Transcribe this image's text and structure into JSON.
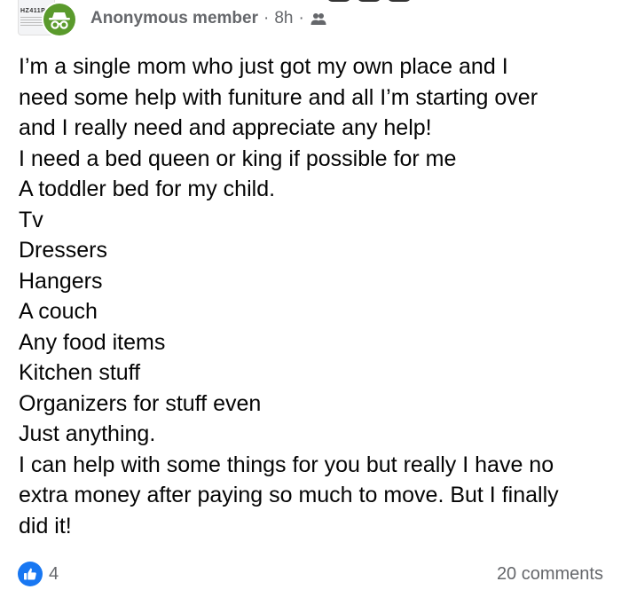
{
  "post": {
    "author": "Anonymous member",
    "separator": "·",
    "time": "8h",
    "privacy_icon": "group-privacy-icon",
    "body": "I’m a single mom who just got my own place and I\nneed some help with funiture and all I’m starting over\nand I really need and appreciate any help!\nI need a bed queen or king if possible for me\nA toddler bed for my child.\nTv\nDressers\nHangers\nA couch\nAny food items\nKitchen stuff\nOrganizers for stuff even\nJust anything.\nI can help with some things for you but really I have no\nextra money after paying so much to move. But I finally\ndid it!"
  },
  "group_thumbnail_text": "HZ411P",
  "footer": {
    "reaction_icon": "like-icon",
    "reaction_count": "4",
    "comments": "20 comments"
  },
  "colors": {
    "anonymous_avatar": "#5a9a2c",
    "like_blue": "#1877f2",
    "meta_gray": "#65676b",
    "text": "#050505"
  }
}
